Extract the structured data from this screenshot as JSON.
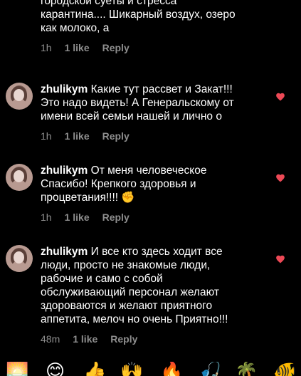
{
  "comments": [
    {
      "text": "городской суеты и стресса\nкарантина.... Шикарный воздух, озеро\nкак молоко, а",
      "time": "1h",
      "likes": "1 like",
      "reply": "Reply"
    },
    {
      "username": "zhulikym",
      "text": " Какие тут рассвет и Закат!!!\nЭто надо видеть! А Генеральскому от\nимени всей семьи нашей и лично о",
      "time": "1h",
      "likes": "1 like",
      "reply": "Reply",
      "liked": true
    },
    {
      "username": "zhulikym",
      "text": " От меня человеческое\nСпасибо! Крепкого здоровья и\nпроцветания!!!! ✊",
      "time": "1h",
      "likes": "1 like",
      "reply": "Reply",
      "liked": true
    },
    {
      "username": "zhulikym",
      "text": " И все кто здесь ходит все\nлюди, просто не знакомые люди,\nрабочие и само с собой\nобслуживающий персонал желают\nздороваются и желают приятного\nаппетита, мелоч но очень Приятно!!!",
      "time": "48m",
      "likes": "1 like",
      "reply": "Reply",
      "liked": true
    }
  ],
  "colors": {
    "background": "#000000",
    "text": "#ffffff",
    "meta": "#8e8e8e",
    "heart": "#ed4956"
  },
  "emoji_bar": [
    "🌅",
    "😊",
    "👍",
    "🙌",
    "🔥",
    "🎣",
    "🌴",
    "🐠"
  ]
}
